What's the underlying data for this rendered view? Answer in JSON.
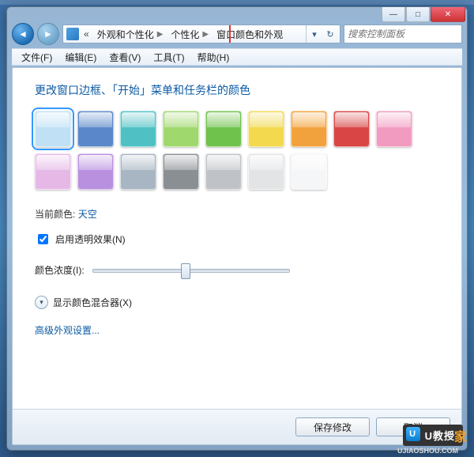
{
  "caption": {
    "min": "—",
    "max": "□",
    "close": "✕"
  },
  "breadcrumb": {
    "ellipsis": "«",
    "level1": "外观和个性化",
    "level2": "个性化",
    "level3": "窗口颜色和外观"
  },
  "search": {
    "placeholder": "搜索控制面板"
  },
  "menu": {
    "file": "文件(F)",
    "edit": "编辑(E)",
    "view": "查看(V)",
    "tools": "工具(T)",
    "help": "帮助(H)"
  },
  "heading": "更改窗口边框、「开始」菜单和任务栏的颜色",
  "swatches": [
    {
      "name": "天空",
      "hex": "#bfe0f5",
      "selected": true
    },
    {
      "name": "蓝",
      "hex": "#5a87c9"
    },
    {
      "name": "青",
      "hex": "#4fc1c4"
    },
    {
      "name": "叶",
      "hex": "#9fd86c"
    },
    {
      "name": "草",
      "hex": "#6fc24b"
    },
    {
      "name": "黄",
      "hex": "#f2d94e"
    },
    {
      "name": "橙",
      "hex": "#f2a23c"
    },
    {
      "name": "红",
      "hex": "#d94545"
    },
    {
      "name": "粉",
      "hex": "#f29bc1"
    },
    {
      "name": "淡紫",
      "hex": "#e6b8e6"
    },
    {
      "name": "紫",
      "hex": "#b98fe0"
    },
    {
      "name": "灰蓝",
      "hex": "#a8b5c2"
    },
    {
      "name": "深灰",
      "hex": "#8a8f94"
    },
    {
      "name": "灰",
      "hex": "#bfc3c7"
    },
    {
      "name": "银",
      "hex": "#e2e4e6"
    },
    {
      "name": "白",
      "hex": "#f5f6f7"
    }
  ],
  "current": {
    "label": "当前颜色:",
    "value": "天空"
  },
  "transparency": {
    "label": "启用透明效果(N)",
    "checked": true
  },
  "intensity": {
    "label": "颜色浓度(I):",
    "value": 47,
    "min": 0,
    "max": 100
  },
  "mixer": {
    "label": "显示颜色混合器(X)"
  },
  "advanced": {
    "label": "高级外观设置..."
  },
  "buttons": {
    "save": "保存修改",
    "cancel": "取消"
  },
  "watermark": {
    "main": "U教授",
    "sub": "UJIAOSHOU.COM",
    "tail": "家"
  }
}
